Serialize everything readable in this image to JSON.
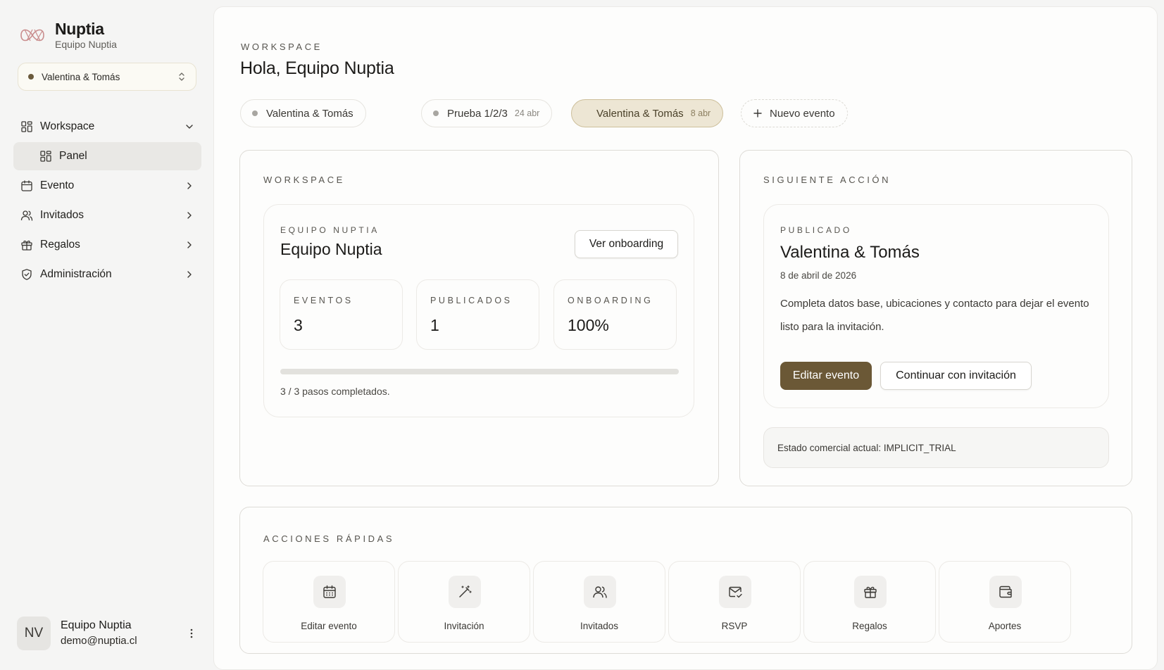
{
  "brand": {
    "name": "Nuptia",
    "subtitle": "Equipo Nuptia"
  },
  "event_selector": {
    "value": "Valentina & Tomás"
  },
  "nav": {
    "workspace": "Workspace",
    "panel": "Panel",
    "evento": "Evento",
    "invitados": "Invitados",
    "regalos": "Regalos",
    "administracion": "Administración"
  },
  "user": {
    "initials": "NV",
    "name": "Equipo Nuptia",
    "email": "demo@nuptia.cl"
  },
  "header": {
    "eyebrow": "WORKSPACE",
    "title": "Hola, Equipo Nuptia"
  },
  "event_pills": [
    {
      "label": "Valentina & Tomás",
      "date": ""
    },
    {
      "label": "Prueba 1/2/3",
      "date": "24 abr"
    },
    {
      "label": "Valentina & Tomás",
      "date": "8 abr"
    }
  ],
  "new_event_label": "Nuevo evento",
  "workspace_card": {
    "eyebrow": "WORKSPACE",
    "team_eyebrow": "EQUIPO NUPTIA",
    "team_name": "Equipo Nuptia",
    "onboarding_button": "Ver onboarding",
    "stats": [
      {
        "label": "EVENTOS",
        "value": "3"
      },
      {
        "label": "PUBLICADOS",
        "value": "1"
      },
      {
        "label": "ONBOARDING",
        "value": "100%"
      }
    ],
    "progress_fraction": 1.0,
    "steps_text": "3 / 3 pasos completados."
  },
  "next_action": {
    "eyebrow": "SIGUIENTE ACCIÓN",
    "status_eyebrow": "PUBLICADO",
    "event_name": "Valentina & Tomás",
    "event_date": "8 de abril de 2026",
    "description": "Completa datos base, ubicaciones y contacto para dejar el evento listo para la invitación.",
    "primary_button": "Editar evento",
    "secondary_button": "Continuar con invitación",
    "commercial_status": "Estado comercial actual: IMPLICIT_TRIAL"
  },
  "quick_actions": {
    "eyebrow": "ACCIONES RÁPIDAS",
    "items": [
      {
        "label": "Editar evento",
        "icon": "calendar-icon"
      },
      {
        "label": "Invitación",
        "icon": "magic-wand-icon"
      },
      {
        "label": "Invitados",
        "icon": "users-icon"
      },
      {
        "label": "RSVP",
        "icon": "mail-check-icon"
      },
      {
        "label": "Regalos",
        "icon": "gift-icon"
      },
      {
        "label": "Aportes",
        "icon": "wallet-icon"
      }
    ]
  },
  "colors": {
    "accent": "#6b5836",
    "active_pill_bg": "#ede6d4",
    "sidebar_bg": "#f5f5f4",
    "panel_active_bg": "#e9e8e5"
  }
}
